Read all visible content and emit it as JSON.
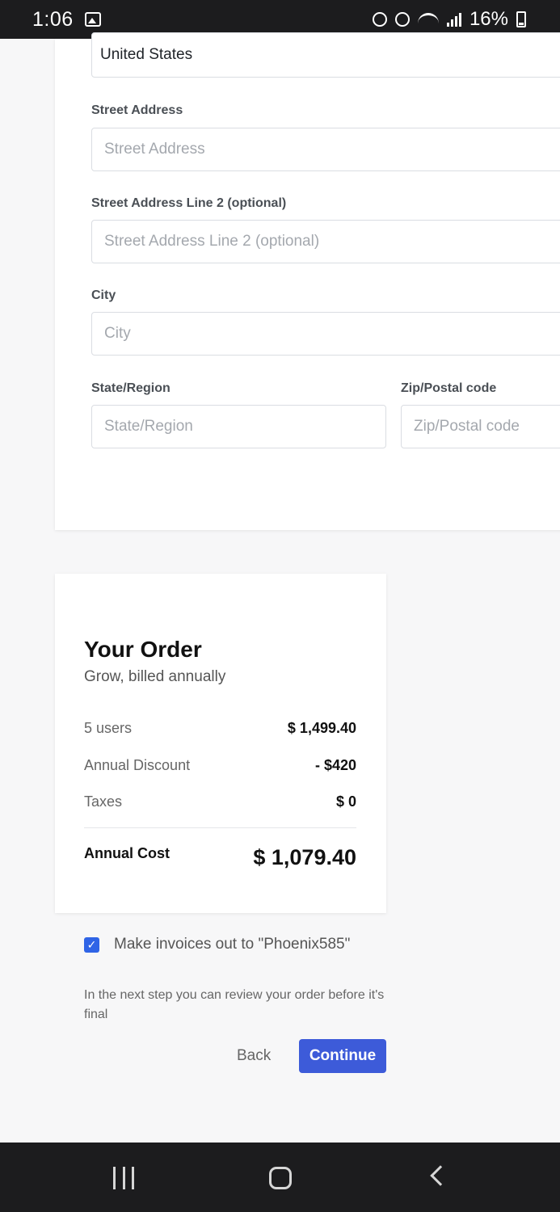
{
  "status_bar": {
    "time": "1:06",
    "battery": "16%"
  },
  "address_form": {
    "country_value": "United States",
    "street_label": "Street Address",
    "street_placeholder": "Street Address",
    "street2_label": "Street Address Line 2 (optional)",
    "street2_placeholder": "Street Address Line 2 (optional)",
    "city_label": "City",
    "city_placeholder": "City",
    "state_label": "State/Region",
    "state_placeholder": "State/Region",
    "zip_label": "Zip/Postal code",
    "zip_placeholder": "Zip/Postal code"
  },
  "order": {
    "title": "Your Order",
    "subtitle": "Grow, billed annually",
    "rows": [
      {
        "label": "5 users",
        "value": "$ 1,499.40"
      },
      {
        "label": "Annual Discount",
        "value": "- $420"
      },
      {
        "label": "Taxes",
        "value": "$ 0"
      }
    ],
    "total_label": "Annual Cost",
    "total_value": "$ 1,079.40"
  },
  "invoice": {
    "checked": true,
    "label": "Make invoices out to \"Phoenix585\""
  },
  "note": "In the next step you can review your order before it's final",
  "actions": {
    "back_label": "Back",
    "continue_label": "Continue"
  },
  "colors": {
    "accent": "#3d5bd9",
    "checkbox": "#2f64e6"
  }
}
